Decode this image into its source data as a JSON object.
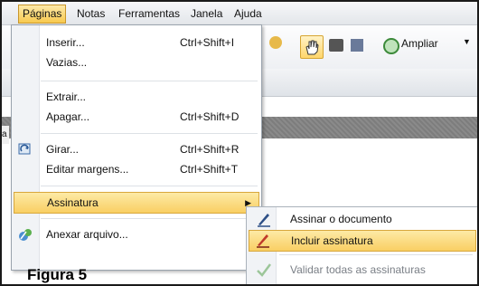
{
  "menubar": {
    "items": [
      "Páginas",
      "Notas",
      "Ferramentas",
      "Janela",
      "Ajuda"
    ]
  },
  "toolbar": {
    "zoom_label": "Ampliar"
  },
  "left_tab_letter": "a",
  "dropdown": {
    "items": [
      {
        "label": "Inserir...",
        "shortcut": "Ctrl+Shift+I"
      },
      {
        "label": "Vazias...",
        "shortcut": ""
      },
      {
        "label": "Extrair...",
        "shortcut": ""
      },
      {
        "label": "Apagar...",
        "shortcut": "Ctrl+Shift+D"
      },
      {
        "label": "Girar...",
        "shortcut": "Ctrl+Shift+R"
      },
      {
        "label": "Editar margens...",
        "shortcut": "Ctrl+Shift+T"
      },
      {
        "label": "Assinatura",
        "shortcut": ""
      },
      {
        "label": "Anexar arquivo...",
        "shortcut": ""
      }
    ]
  },
  "submenu": {
    "items": [
      {
        "label": "Assinar o documento"
      },
      {
        "label": "Incluir assinatura"
      },
      {
        "label": "Validar todas as assinaturas"
      }
    ]
  },
  "caption": "Figura 5",
  "colors": {
    "highlight": "#f9cf63",
    "highlight_border": "#d8a73c",
    "menu_border": "#9aa3ad"
  }
}
